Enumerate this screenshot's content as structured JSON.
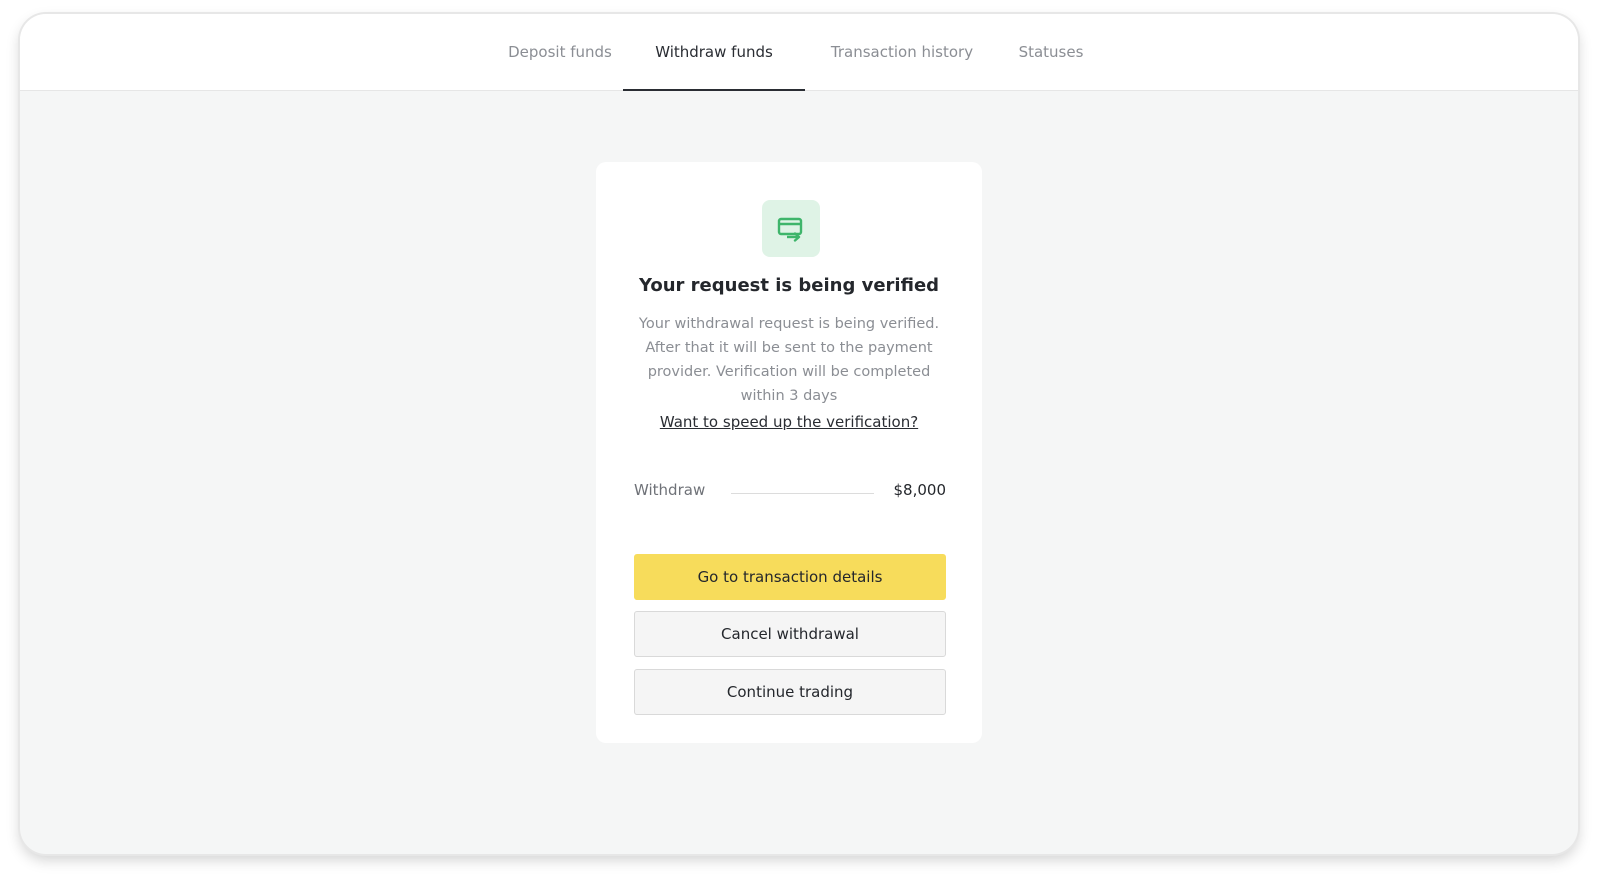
{
  "tabs": [
    {
      "label": "Deposit funds"
    },
    {
      "label": "Withdraw funds"
    },
    {
      "label": "Transaction history"
    },
    {
      "label": "Statuses"
    }
  ],
  "active_tab": "Withdraw funds",
  "card": {
    "icon": "transfer-icon",
    "title": "Your request is being verified",
    "description": "Your withdrawal request is being verified. After that it will be sent to the payment provider. Verification will be completed within 3 days",
    "speed_link": "Want to speed up the verification?",
    "amount_label": "Withdraw",
    "amount_value": "$8,000",
    "buttons": {
      "details": "Go to transaction details",
      "cancel": "Cancel withdrawal",
      "continue": "Continue trading"
    }
  },
  "colors": {
    "accent": "#f7dc5b",
    "icon_bg": "#dff3e6",
    "icon_fg": "#3fb56b"
  }
}
